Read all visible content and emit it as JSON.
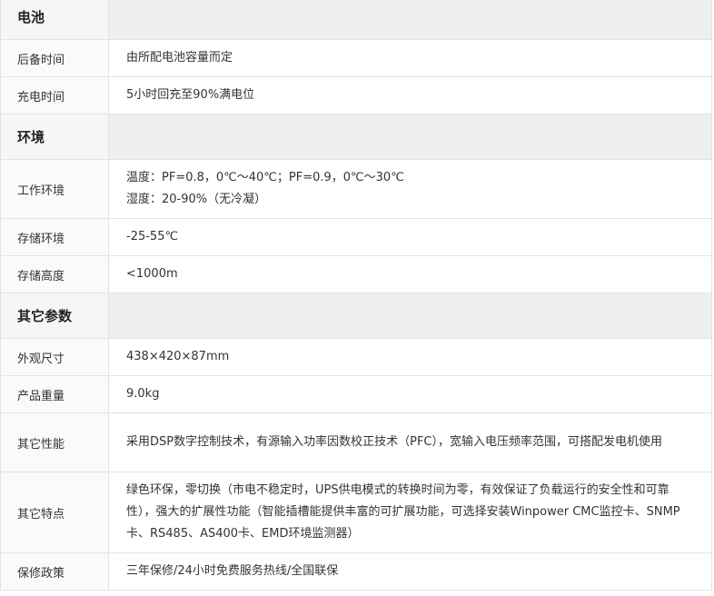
{
  "sections": [
    {
      "title": "电池",
      "rows": [
        {
          "label": "后备时间",
          "lines": [
            "由所配电池容量而定"
          ]
        },
        {
          "label": "充电时间",
          "lines": [
            "5小时回充至90%满电位"
          ]
        }
      ]
    },
    {
      "title": "环境",
      "rows": [
        {
          "label": "工作环境",
          "lines": [
            "温度：PF=0.8，0℃～40℃；PF=0.9，0℃～30℃",
            "湿度：20-90%（无冷凝）"
          ]
        },
        {
          "label": "存储环境",
          "lines": [
            "-25-55℃"
          ]
        },
        {
          "label": "存储高度",
          "lines": [
            "<1000m"
          ]
        }
      ]
    },
    {
      "title": "其它参数",
      "rows": [
        {
          "label": "外观尺寸",
          "lines": [
            "438×420×87mm"
          ]
        },
        {
          "label": "产品重量",
          "lines": [
            "9.0kg"
          ]
        },
        {
          "label": "其它性能",
          "lines": [
            "采用DSP数字控制技术，有源输入功率因数校正技术（PFC），宽输入电压频率范围，可搭配发电机使用"
          ]
        },
        {
          "label": "其它特点",
          "lines": [
            "绿色环保，零切换（市电不稳定时，UPS供电模式的转换时间为零，有效保证了负载运行的安全性和可靠性），强大的扩展性功能（智能插槽能提供丰富的可扩展功能，可选择安装Winpower CMC监控卡、SNMP卡、RS485、AS400卡、EMD环境监测器）"
          ]
        },
        {
          "label": "保修政策",
          "lines": [
            "三年保修/24小时免费服务热线/全国联保"
          ]
        }
      ]
    }
  ]
}
